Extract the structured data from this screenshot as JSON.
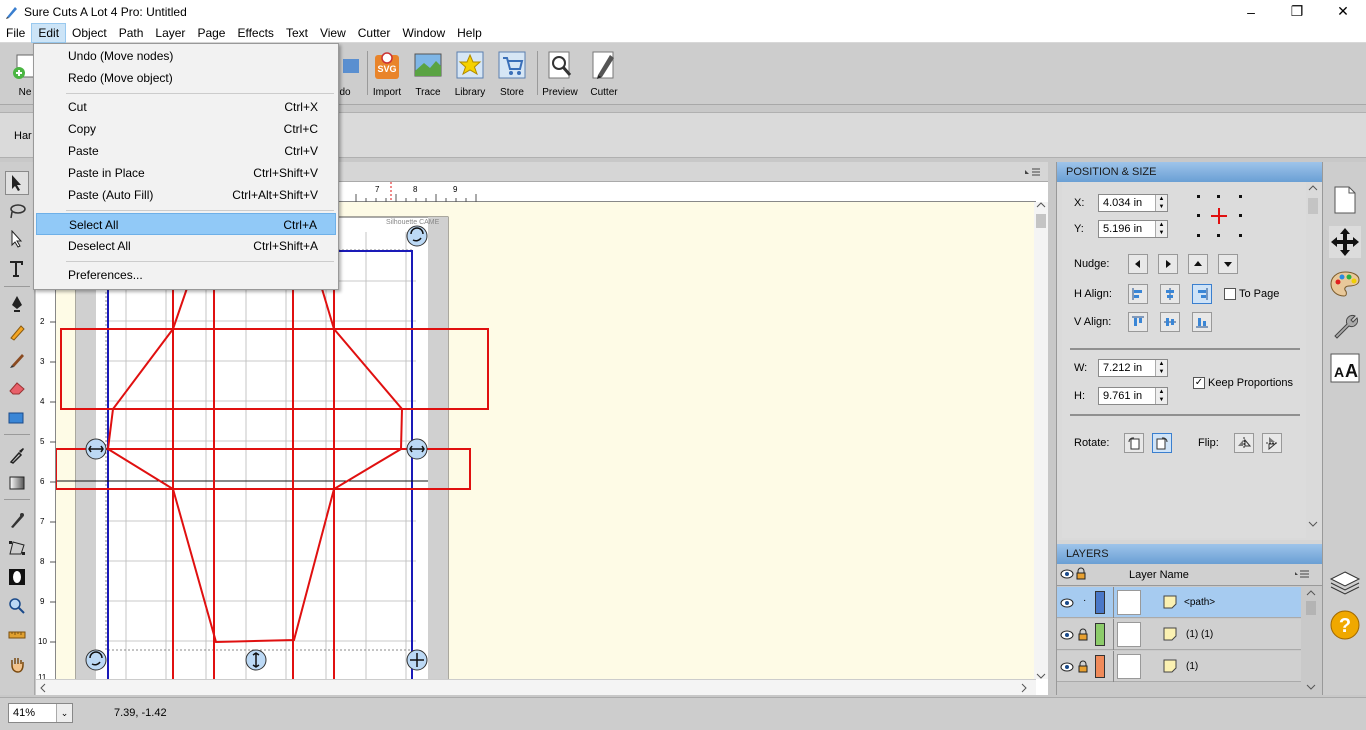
{
  "window": {
    "title": "Sure Cuts A Lot 4 Pro: Untitled",
    "minimize": "–",
    "maximize": "❐",
    "close": "✕"
  },
  "menubar": [
    "File",
    "Edit",
    "Object",
    "Path",
    "Layer",
    "Page",
    "Effects",
    "Text",
    "View",
    "Cutter",
    "Window",
    "Help"
  ],
  "toolbar": {
    "partial_new": "Ne",
    "partial_redo": "do",
    "buttons": [
      "Import",
      "Trace",
      "Library",
      "Store",
      "Preview",
      "Cutter"
    ]
  },
  "propsbar": {
    "partial_label": "Har"
  },
  "edit_menu": {
    "items": [
      {
        "label": "Undo (Move nodes)",
        "shortcut": ""
      },
      {
        "label": "Redo (Move object)",
        "shortcut": ""
      },
      {
        "label": "Cut",
        "shortcut": "Ctrl+X"
      },
      {
        "label": "Copy",
        "shortcut": "Ctrl+C"
      },
      {
        "label": "Paste",
        "shortcut": "Ctrl+V"
      },
      {
        "label": "Paste in Place",
        "shortcut": "Ctrl+Shift+V"
      },
      {
        "label": "Paste (Auto Fill)",
        "shortcut": "Ctrl+Alt+Shift+V"
      },
      {
        "label": "Select All",
        "shortcut": "Ctrl+A"
      },
      {
        "label": "Deselect All",
        "shortcut": "Ctrl+Shift+A"
      },
      {
        "label": "Preferences...",
        "shortcut": ""
      }
    ]
  },
  "ruler": {
    "h_labels": [
      "7",
      "8",
      "9"
    ],
    "v_labels": [
      "2",
      "3",
      "4",
      "5",
      "6",
      "7",
      "8",
      "9",
      "10",
      "11"
    ]
  },
  "mat_label": "Silhouette CAME",
  "position_size": {
    "header": "POSITION & SIZE",
    "x_label": "X:",
    "x_value": "4.034 in",
    "y_label": "Y:",
    "y_value": "5.196 in",
    "nudge_label": "Nudge:",
    "halign_label": "H Align:",
    "valign_label": "V Align:",
    "to_page_label": "To Page",
    "w_label": "W:",
    "w_value": "7.212 in",
    "h_label": "H:",
    "h_value": "9.761 in",
    "keep_proportions_label": "Keep Proportions",
    "keep_proportions_checked": true,
    "to_page_checked": false,
    "rotate_label": "Rotate:",
    "flip_label": "Flip:"
  },
  "layers": {
    "header": "LAYERS",
    "column": "Layer Name",
    "rows": [
      {
        "name": "<path>",
        "color": "#4a78c8",
        "locked": false,
        "selected": true
      },
      {
        "name": "(1) (1)",
        "color": "#8ccb6a",
        "locked": true,
        "selected": false
      },
      {
        "name": "(1)",
        "color": "#f08a5a",
        "locked": true,
        "selected": false
      }
    ]
  },
  "statusbar": {
    "zoom": "41%",
    "coords": "7.39, -1.42"
  },
  "colors": {
    "accent": "#91c9f7",
    "cut_line": "#e01010",
    "mat_border": "#1a1ab8",
    "workspace": "#fefbe6"
  }
}
